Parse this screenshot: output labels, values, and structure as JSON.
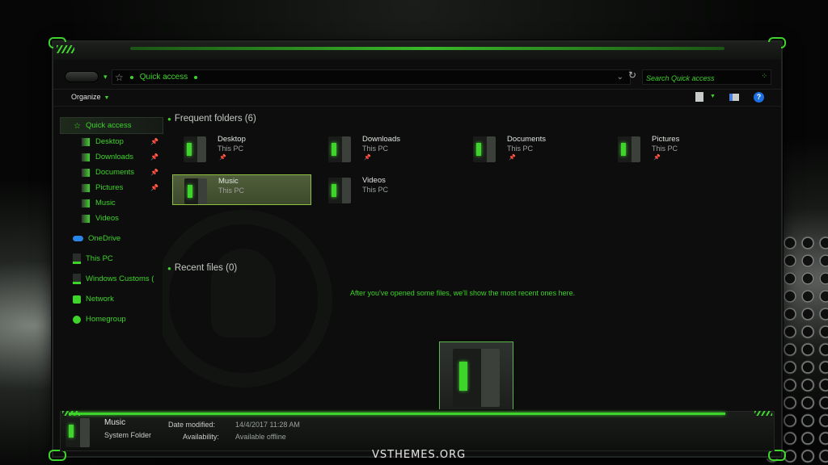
{
  "address_bar": {
    "location": "Quick access"
  },
  "search": {
    "placeholder": "Search Quick access"
  },
  "command_bar": {
    "organize_label": "Organize"
  },
  "nav_pane": {
    "quick_access": "Quick access",
    "pinned": [
      {
        "label": "Desktop",
        "pinned": true
      },
      {
        "label": "Downloads",
        "pinned": true
      },
      {
        "label": "Documents",
        "pinned": true
      },
      {
        "label": "Pictures",
        "pinned": true
      },
      {
        "label": "Music",
        "pinned": false
      },
      {
        "label": "Videos",
        "pinned": false
      }
    ],
    "onedrive": "OneDrive",
    "this_pc": "This PC",
    "windows_customs": "Windows Customs (",
    "network": "Network",
    "homegroup": "Homegroup"
  },
  "frequent": {
    "title": "Frequent folders (6)",
    "folders": [
      {
        "name": "Desktop",
        "location": "This PC"
      },
      {
        "name": "Downloads",
        "location": "This PC"
      },
      {
        "name": "Documents",
        "location": "This PC"
      },
      {
        "name": "Pictures",
        "location": "This PC"
      },
      {
        "name": "Music",
        "location": "This PC"
      },
      {
        "name": "Videos",
        "location": "This PC"
      }
    ]
  },
  "recent": {
    "title": "Recent files (0)",
    "empty_message": "After you've opened some files, we'll show the most recent ones here."
  },
  "details": {
    "name": "Music",
    "type": "System Folder",
    "date_label": "Date modified:",
    "date_value": "14/4/2017 11:28 AM",
    "avail_label": "Availability:",
    "avail_value": "Available offline"
  },
  "watermark": "VSTHEMES.ORG",
  "colors": {
    "accent": "#3fd42b",
    "background": "#0c0d0c"
  }
}
